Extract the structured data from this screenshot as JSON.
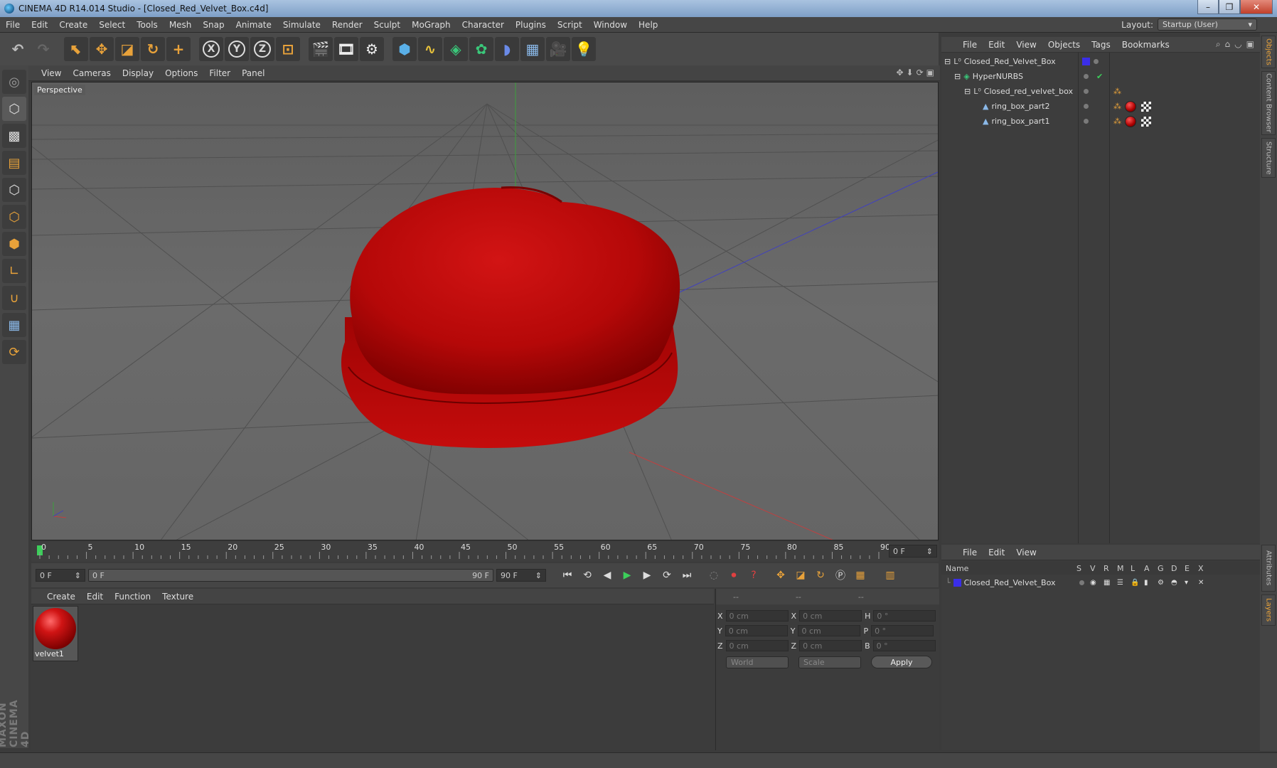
{
  "window": {
    "title": "CINEMA 4D R14.014 Studio - [Closed_Red_Velvet_Box.c4d]",
    "minimize": "–",
    "maximize": "❐",
    "close": "✕"
  },
  "menubar": {
    "items": [
      "File",
      "Edit",
      "Create",
      "Select",
      "Tools",
      "Mesh",
      "Snap",
      "Animate",
      "Simulate",
      "Render",
      "Sculpt",
      "MoGraph",
      "Character",
      "Plugins",
      "Script",
      "Window",
      "Help"
    ],
    "layout_label": "Layout:",
    "layout_value": "Startup (User)"
  },
  "toolbar": {
    "icons": [
      "undo-icon",
      "redo-icon",
      "live-selection-icon",
      "move-icon",
      "scale-icon",
      "rotate-icon",
      "add-icon",
      "x-axis-icon",
      "y-axis-icon",
      "z-axis-icon",
      "world-coordinates-icon",
      "render-view-icon",
      "render-picture-viewer-icon",
      "edit-render-settings-icon",
      "cube-icon",
      "spline-icon",
      "nurbs-icon",
      "array-icon",
      "deformer-icon",
      "floor-icon",
      "camera-icon",
      "light-icon"
    ],
    "axis_x": "X",
    "axis_y": "Y",
    "axis_z": "Z"
  },
  "viewport": {
    "menu": [
      "View",
      "Cameras",
      "Display",
      "Options",
      "Filter",
      "Panel"
    ],
    "label": "Perspective"
  },
  "timeline": {
    "ticks": [
      "0",
      "5",
      "10",
      "15",
      "20",
      "25",
      "30",
      "35",
      "40",
      "45",
      "50",
      "55",
      "60",
      "65",
      "70",
      "75",
      "80",
      "85",
      "90"
    ],
    "current": "0 F",
    "start_field": "0 F",
    "range_start": "0 F",
    "range_end": "90 F",
    "end_field": "90 F"
  },
  "materials": {
    "menu": [
      "Create",
      "Edit",
      "Function",
      "Texture"
    ],
    "items": [
      {
        "name": "velvet1"
      }
    ]
  },
  "coords": {
    "headers": [
      "--",
      "--",
      "--"
    ],
    "rows": [
      {
        "a": "X",
        "v1": "0 cm",
        "b": "X",
        "v2": "0 cm",
        "c": "H",
        "v3": "0 °"
      },
      {
        "a": "Y",
        "v1": "0 cm",
        "b": "Y",
        "v2": "0 cm",
        "c": "P",
        "v3": "0 °"
      },
      {
        "a": "Z",
        "v1": "0 cm",
        "b": "Z",
        "v2": "0 cm",
        "c": "B",
        "v3": "0 °"
      }
    ],
    "mode": "World",
    "transform": "Scale",
    "apply": "Apply"
  },
  "objects": {
    "menu": [
      "File",
      "Edit",
      "View",
      "Objects",
      "Tags",
      "Bookmarks"
    ],
    "tree": [
      {
        "name": "Closed_Red_Velvet_Box"
      },
      {
        "name": "HyperNURBS"
      },
      {
        "name": "Closed_red_velvet_box"
      },
      {
        "name": "ring_box_part2"
      },
      {
        "name": "ring_box_part1"
      }
    ]
  },
  "layers": {
    "menu": [
      "File",
      "Edit",
      "View"
    ],
    "columns": [
      "Name",
      "S",
      "V",
      "R",
      "M",
      "L",
      "A",
      "G",
      "D",
      "E",
      "X"
    ],
    "rows": [
      {
        "name": "Closed_Red_Velvet_Box"
      }
    ]
  },
  "right_tabs": [
    "Objects",
    "Content Browser",
    "Structure",
    "Attributes",
    "Layers"
  ],
  "maxon": "MAXON CINEMA 4D",
  "colors": {
    "accent": "#e8a23a",
    "velvet": "#c80f0f",
    "layer": "#3a2ee8"
  }
}
